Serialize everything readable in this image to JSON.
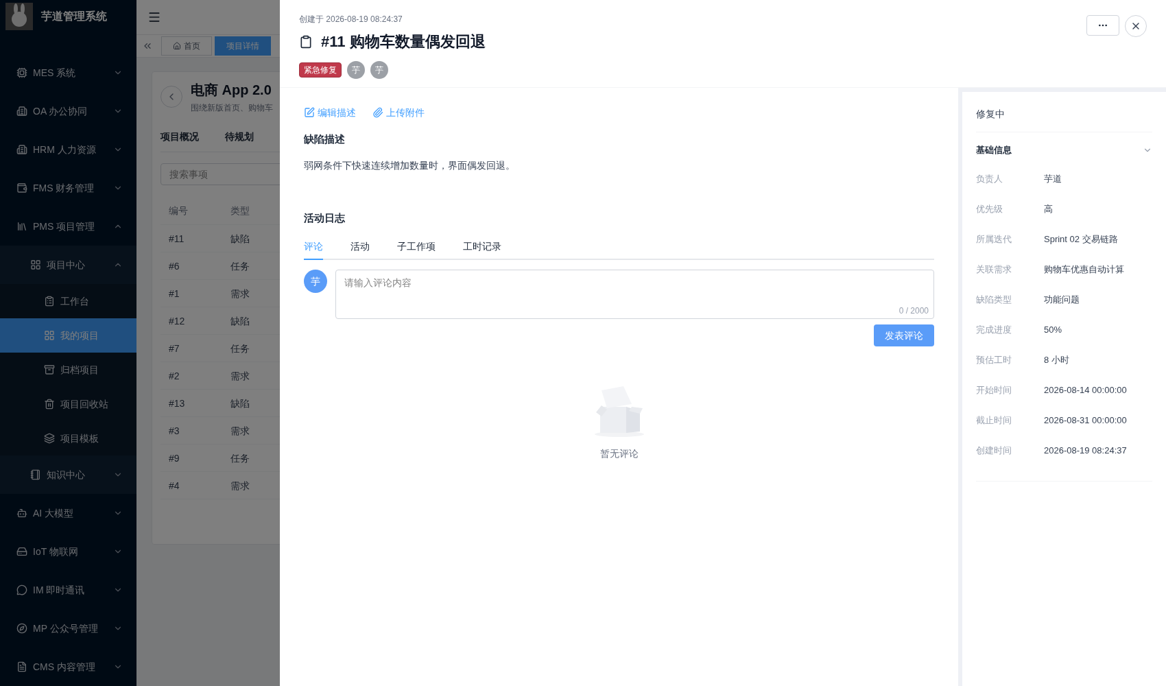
{
  "sidebar": {
    "title": "芋道管理系统",
    "items": [
      {
        "label": "MES 系统",
        "expanded": false,
        "selected": false
      },
      {
        "label": "OA 办公协同",
        "expanded": false,
        "selected": false
      },
      {
        "label": "HRM 人力资源",
        "expanded": false,
        "selected": false
      },
      {
        "label": "FMS 财务管理",
        "expanded": false,
        "selected": false
      },
      {
        "label": "PMS 项目管理",
        "expanded": true,
        "selected": false,
        "children": [
          {
            "label": "项目中心",
            "expanded": true,
            "selected": false,
            "children": [
              {
                "label": "工作台",
                "selected": false
              },
              {
                "label": "我的项目",
                "selected": true
              },
              {
                "label": "归档项目",
                "selected": false
              },
              {
                "label": "项目回收站",
                "selected": false
              },
              {
                "label": "项目模板",
                "selected": false
              }
            ]
          },
          {
            "label": "知识中心",
            "expanded": false,
            "selected": false
          }
        ]
      },
      {
        "label": "AI 大模型",
        "expanded": false,
        "selected": false
      },
      {
        "label": "IoT 物联网",
        "expanded": false,
        "selected": false
      },
      {
        "label": "IM 即时通讯",
        "expanded": false,
        "selected": false
      },
      {
        "label": "MP 公众号管理",
        "expanded": false,
        "selected": false
      },
      {
        "label": "CMS 内容管理",
        "expanded": false,
        "selected": false
      }
    ]
  },
  "tabs": [
    {
      "label": "首页",
      "selected": false
    },
    {
      "label": "项目详情",
      "selected": true
    }
  ],
  "project": {
    "title": "电商 App 2.0",
    "subtitle": "围绕新版首页、购物车",
    "tabs": [
      "项目概况",
      "待规划"
    ],
    "search": {
      "placeholder": "搜索事项"
    },
    "table": {
      "columns": [
        "编号",
        "类型"
      ],
      "rows": [
        [
          "#11",
          "缺陷"
        ],
        [
          "#6",
          "任务"
        ],
        [
          "#1",
          "需求"
        ],
        [
          "#12",
          "缺陷"
        ],
        [
          "#7",
          "任务"
        ],
        [
          "#2",
          "需求"
        ],
        [
          "#13",
          "缺陷"
        ],
        [
          "#3",
          "需求"
        ],
        [
          "#9",
          "任务"
        ],
        [
          "#4",
          "需求"
        ]
      ]
    }
  },
  "drawer": {
    "created": "创建于 2026-08-19 08:24:37",
    "title": "#11 购物车数量偶发回退",
    "tag": "紧急修复",
    "assignees": [
      "芋",
      "芋"
    ],
    "actions": [
      "编辑描述",
      "上传附件"
    ],
    "description_title": "缺陷描述",
    "description": "弱网条件下快速连续增加数量时，界面偶发回退。",
    "activity_title": "活动日志",
    "activity_tabs": [
      {
        "label": "评论",
        "selected": true
      },
      {
        "label": "活动",
        "selected": false
      },
      {
        "label": "子工作项",
        "selected": false
      },
      {
        "label": "工时记录",
        "selected": false
      }
    ],
    "comment": {
      "avatar": "芋",
      "placeholder": "请输入评论内容",
      "counter": "0 / 2000",
      "submit": "发表评论"
    },
    "empty": "暂无评论",
    "status": "修复中",
    "info": {
      "title": "基础信息",
      "expanded": true,
      "fields": [
        {
          "label": "负责人",
          "value": "芋道"
        },
        {
          "label": "优先级",
          "value": "高"
        },
        {
          "label": "所属迭代",
          "value": "Sprint 02 交易链路"
        },
        {
          "label": "关联需求",
          "value": "购物车优惠自动计算"
        },
        {
          "label": "缺陷类型",
          "value": "功能问题"
        },
        {
          "label": "完成进度",
          "value": "50%"
        },
        {
          "label": "预估工时",
          "value": "8 小时"
        },
        {
          "label": "开始时间",
          "value": "2026-08-14 00:00:00"
        },
        {
          "label": "截止时间",
          "value": "2026-08-31 00:00:00"
        },
        {
          "label": "创建时间",
          "value": "2026-08-19 08:24:37"
        }
      ]
    }
  }
}
